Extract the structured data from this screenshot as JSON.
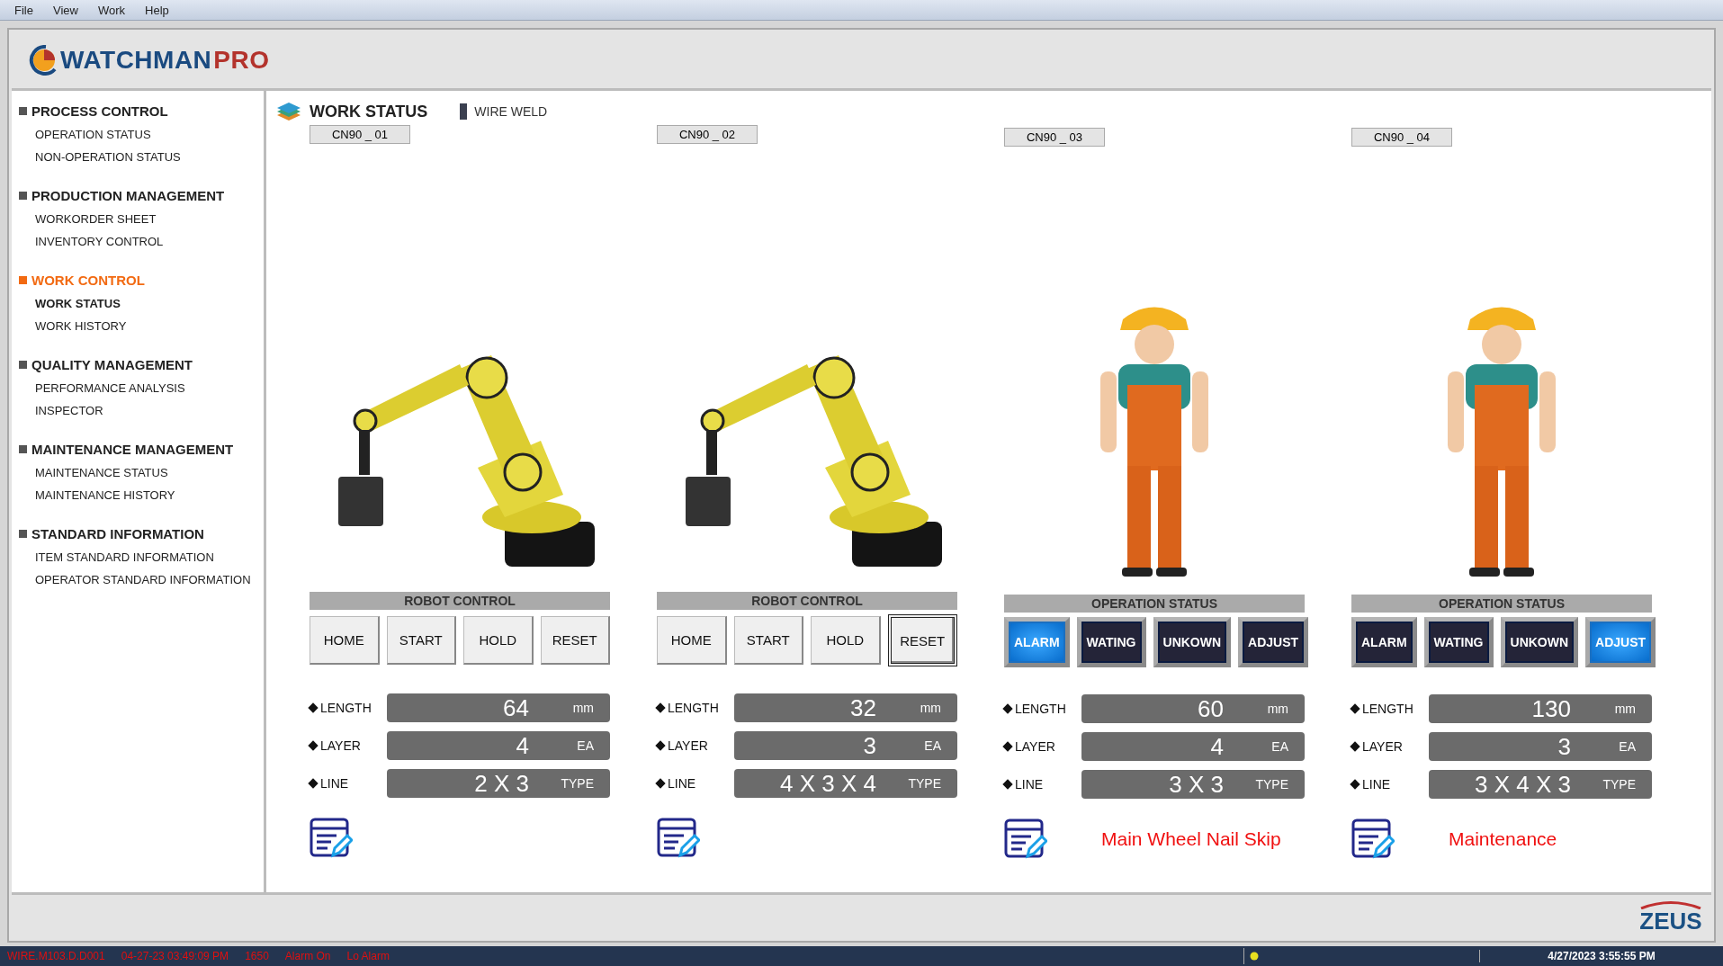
{
  "menu": [
    "File",
    "View",
    "Work",
    "Help"
  ],
  "logo": {
    "word_a": "WATCHMAN",
    "word_b": "PRO"
  },
  "sidebar": [
    {
      "title": "PROCESS CONTROL",
      "selected": false,
      "items": [
        {
          "label": "OPERATION STATUS",
          "selected": false
        },
        {
          "label": "NON-OPERATION STATUS",
          "selected": false
        }
      ]
    },
    {
      "title": "PRODUCTION MANAGEMENT",
      "selected": false,
      "items": [
        {
          "label": "WORKORDER SHEET",
          "selected": false
        },
        {
          "label": "INVENTORY CONTROL",
          "selected": false
        }
      ]
    },
    {
      "title": "WORK CONTROL",
      "selected": true,
      "items": [
        {
          "label": "WORK STATUS",
          "selected": true
        },
        {
          "label": "WORK HISTORY",
          "selected": false
        }
      ]
    },
    {
      "title": "QUALITY MANAGEMENT",
      "selected": false,
      "items": [
        {
          "label": "PERFORMANCE ANALYSIS",
          "selected": false
        },
        {
          "label": "INSPECTOR",
          "selected": false
        }
      ]
    },
    {
      "title": "MAINTENANCE MANAGEMENT",
      "selected": false,
      "items": [
        {
          "label": "MAINTENANCE STATUS",
          "selected": false
        },
        {
          "label": "MAINTENANCE HISTORY",
          "selected": false
        }
      ]
    },
    {
      "title": "STANDARD INFORMATION",
      "selected": false,
      "items": [
        {
          "label": "ITEM STANDARD INFORMATION",
          "selected": false
        },
        {
          "label": "OPERATOR STANDARD INFORMATION",
          "selected": false
        }
      ]
    }
  ],
  "page": {
    "title": "WORK STATUS",
    "subtitle": "WIRE WELD"
  },
  "machines": [
    {
      "tag": "CN90 _ 01",
      "figure": {
        "kind": "robot"
      },
      "control": {
        "kind": "robot",
        "title": "ROBOT CONTROL",
        "buttons": [
          {
            "label": "HOME",
            "selected": false
          },
          {
            "label": "START",
            "selected": false
          },
          {
            "label": "HOLD",
            "selected": false
          },
          {
            "label": "RESET",
            "selected": false
          }
        ]
      },
      "readings": [
        {
          "label": "LENGTH",
          "value": "64",
          "unit": "mm"
        },
        {
          "label": "LAYER",
          "value": "4",
          "unit": "EA"
        },
        {
          "label": "LINE",
          "value": "2 X 3",
          "unit": "TYPE"
        }
      ]
    },
    {
      "tag": "CN90 _ 02",
      "figure": {
        "kind": "robot"
      },
      "control": {
        "kind": "robot",
        "title": "ROBOT CONTROL",
        "buttons": [
          {
            "label": "HOME",
            "selected": false
          },
          {
            "label": "START",
            "selected": false
          },
          {
            "label": "HOLD",
            "selected": false
          },
          {
            "label": "RESET",
            "selected": true
          }
        ]
      },
      "readings": [
        {
          "label": "LENGTH",
          "value": "32",
          "unit": "mm"
        },
        {
          "label": "LAYER",
          "value": "3",
          "unit": "EA"
        },
        {
          "label": "LINE",
          "value": "4 X 3 X 4",
          "unit": "TYPE"
        }
      ]
    },
    {
      "tag": "CN90 _ 03",
      "figure": {
        "kind": "worker"
      },
      "control": {
        "kind": "status",
        "title": "OPERATION STATUS",
        "buttons": [
          {
            "label": "ALARM",
            "selected": true
          },
          {
            "label": "WATING",
            "selected": false
          },
          {
            "label": "UNKOWN",
            "selected": false
          },
          {
            "label": "ADJUST",
            "selected": false
          }
        ]
      },
      "readings": [
        {
          "label": "LENGTH",
          "value": "60",
          "unit": "mm"
        },
        {
          "label": "LAYER",
          "value": "4",
          "unit": "EA"
        },
        {
          "label": "LINE",
          "value": "3 X 3",
          "unit": "TYPE"
        }
      ],
      "note": "Main Wheel Nail Skip"
    },
    {
      "tag": "CN90 _ 04",
      "figure": {
        "kind": "worker"
      },
      "control": {
        "kind": "status",
        "title": "OPERATION STATUS",
        "buttons": [
          {
            "label": "ALARM",
            "selected": false
          },
          {
            "label": "WATING",
            "selected": false
          },
          {
            "label": "UNKOWN",
            "selected": false
          },
          {
            "label": "ADJUST",
            "selected": true
          }
        ]
      },
      "readings": [
        {
          "label": "LENGTH",
          "value": "130",
          "unit": "mm"
        },
        {
          "label": "LAYER",
          "value": "3",
          "unit": "EA"
        },
        {
          "label": "LINE",
          "value": "3 X 4 X 3",
          "unit": "TYPE"
        }
      ],
      "note": "Maintenance"
    }
  ],
  "footer_logo": "ZEUS",
  "status_bar": {
    "alarm_fields": [
      "WIRE.M103.D.D001",
      "04-27-23 03:49:09 PM",
      "1650",
      "Alarm On",
      "Lo Alarm"
    ],
    "datetime": "4/27/2023 3:55:55 PM"
  }
}
